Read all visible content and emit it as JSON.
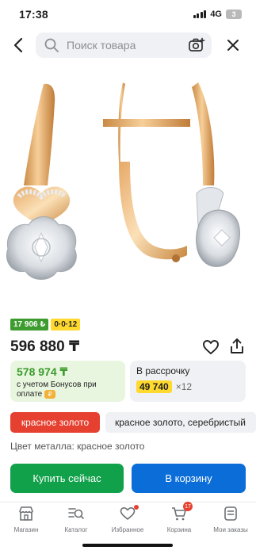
{
  "status": {
    "time": "17:38",
    "network": "4G",
    "battery": "3"
  },
  "search": {
    "placeholder": "Поиск товара"
  },
  "icons": {
    "back": "chevron-left-icon",
    "search": "magnifier-icon",
    "camera": "camera-plus-icon",
    "close": "close-icon",
    "favorite": "heart-outline-icon",
    "share": "share-icon"
  },
  "product": {
    "badges": {
      "bonus": "17 906 ₺",
      "installment": "0·0·12"
    },
    "price": "596 880 ₸",
    "bonus_card": {
      "price": "578 974 ₸",
      "note": "с учетом Бонусов при оплате"
    },
    "installment_card": {
      "title": "В рассрочку",
      "amount": "49 740",
      "multiplier": "×12"
    },
    "colors": {
      "active": "красное золото",
      "other": "красное золото, серебристый"
    },
    "metal": "Цвет металла: красное золото",
    "buy_label": "Купить сейчас",
    "cart_label": "В корзину"
  },
  "tabs": [
    {
      "label": "Магазин",
      "icon": "store-icon"
    },
    {
      "label": "Каталог",
      "icon": "catalog-search-icon"
    },
    {
      "label": "Избранное",
      "icon": "heart-icon"
    },
    {
      "label": "Корзина",
      "icon": "cart-icon",
      "count": "17"
    },
    {
      "label": "Мои заказы",
      "icon": "orders-icon"
    }
  ],
  "colors": {
    "accent_green": "#10a14a",
    "accent_blue": "#0a6dd8",
    "accent_red": "#e64130",
    "bonus_green": "#3a9b2c",
    "yellow": "#ffd92e"
  }
}
